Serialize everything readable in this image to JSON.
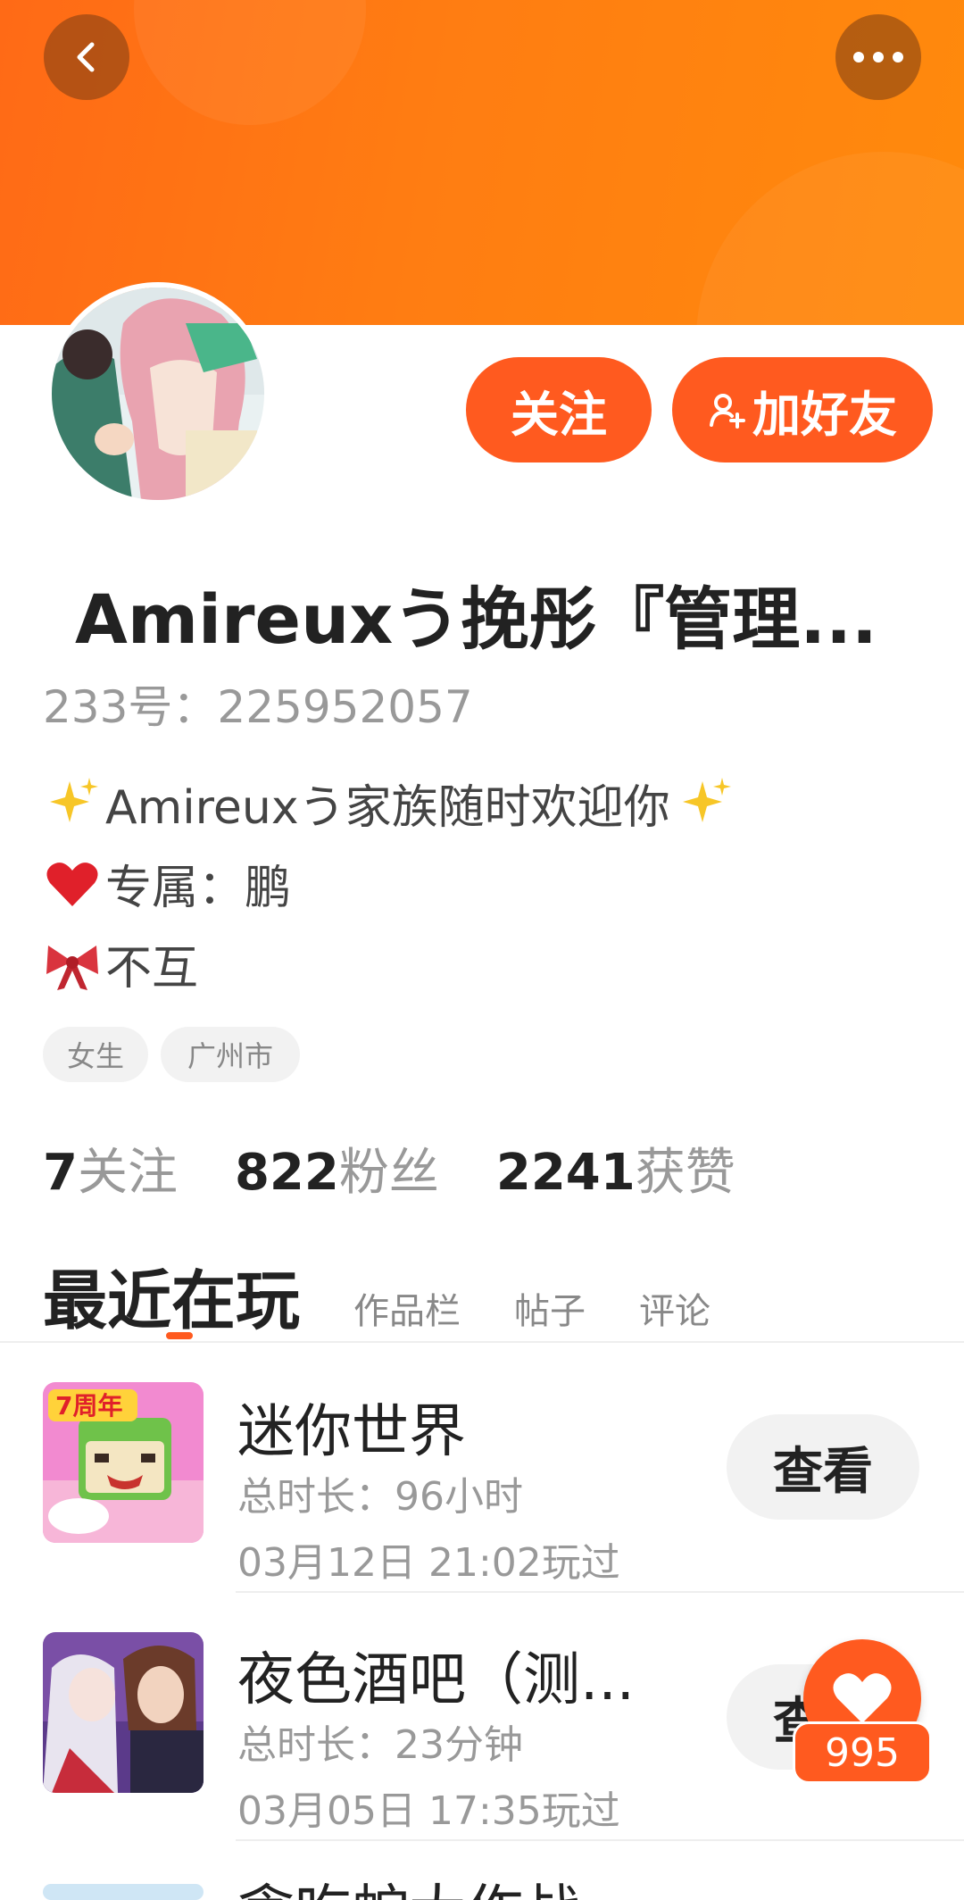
{
  "header": {
    "back_icon": "chevron-left-icon",
    "more_icon": "more-dots-icon",
    "bg_color": "#ff7414"
  },
  "actions": {
    "follow_label": "关注",
    "add_friend_label": "加好友",
    "add_friend_icon": "person-plus-icon",
    "accent_color": "#ff5a1f"
  },
  "profile": {
    "username": "Amireuxう挽彤『管理...",
    "uid": "233号：225952057",
    "bio": [
      {
        "icon": "sparkles-icon",
        "text": "Amireuxう家族随时欢迎你",
        "icon_after": "sparkles-icon"
      },
      {
        "icon": "red-heart-icon",
        "text": "专属：鹏"
      },
      {
        "icon": "ribbon-icon",
        "text": "不互"
      }
    ],
    "tags": [
      "女生",
      "广州市"
    ]
  },
  "stats": [
    {
      "value": "7",
      "label": "关注"
    },
    {
      "value": "822",
      "label": "粉丝"
    },
    {
      "value": "2241",
      "label": "获赞"
    }
  ],
  "tabs": [
    "最近在玩",
    "作品栏",
    "帖子",
    "评论"
  ],
  "games": [
    {
      "name": "迷你世界",
      "duration": "总时长：96小时",
      "played": "03月12日 21:02玩过",
      "button": "查看",
      "badge": "7周年"
    },
    {
      "name": "夜色酒吧（测...",
      "duration": "总时长：23分钟",
      "played": "03月05日 17:35玩过",
      "button": "查看"
    },
    {
      "name": "贪吃蛇大作战"
    }
  ],
  "like": {
    "icon": "heart-icon",
    "count": "995"
  }
}
